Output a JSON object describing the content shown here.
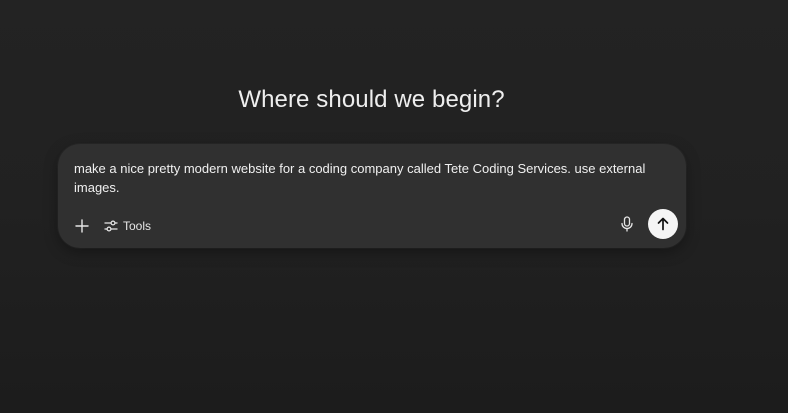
{
  "heading": "Where should we begin?",
  "composer": {
    "prompt_value": "make a nice pretty modern website for a coding company called Tete Coding Services. use external images.",
    "tools_label": "Tools",
    "icons": {
      "add": "plus-icon",
      "tools": "sliders-icon",
      "mic": "microphone-icon",
      "send": "arrow-up-icon"
    }
  },
  "colors": {
    "background": "#212121",
    "composer_bg": "#303030",
    "text": "#ececec",
    "send_button_bg": "#f5f5f5"
  }
}
